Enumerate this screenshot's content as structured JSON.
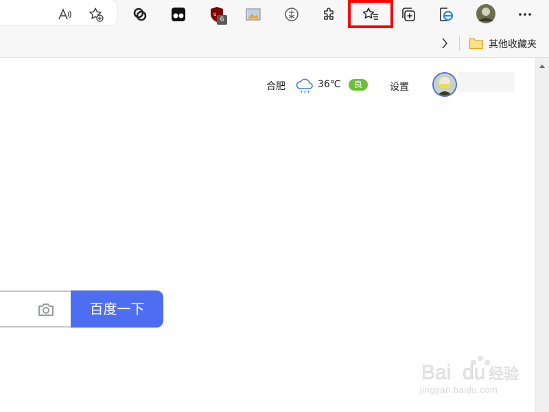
{
  "browser": {
    "toolbar": {
      "extension_badge_count": "6",
      "icons": [
        "read-aloud-icon",
        "add-favorite-icon",
        "extension-link-icon",
        "extension-tampermonkey-icon",
        "extension-ublock-icon",
        "extension-image-icon",
        "extension-circle-icon",
        "extensions-puzzle-icon",
        "favorites-icon",
        "collections-icon",
        "ie-mode-icon",
        "profile-avatar",
        "more-menu-icon"
      ],
      "highlight_color": "#ff0000"
    },
    "favorites_bar": {
      "other_favorites_label": "其他收藏夹"
    }
  },
  "page": {
    "header": {
      "city": "合肥",
      "temperature": "36℃",
      "air_quality": "良",
      "settings_label": "设置"
    },
    "search": {
      "button_label": "百度一下",
      "accent_color": "#4e6ef2"
    },
    "watermark": {
      "text": "jingyan.baidu.com"
    }
  }
}
